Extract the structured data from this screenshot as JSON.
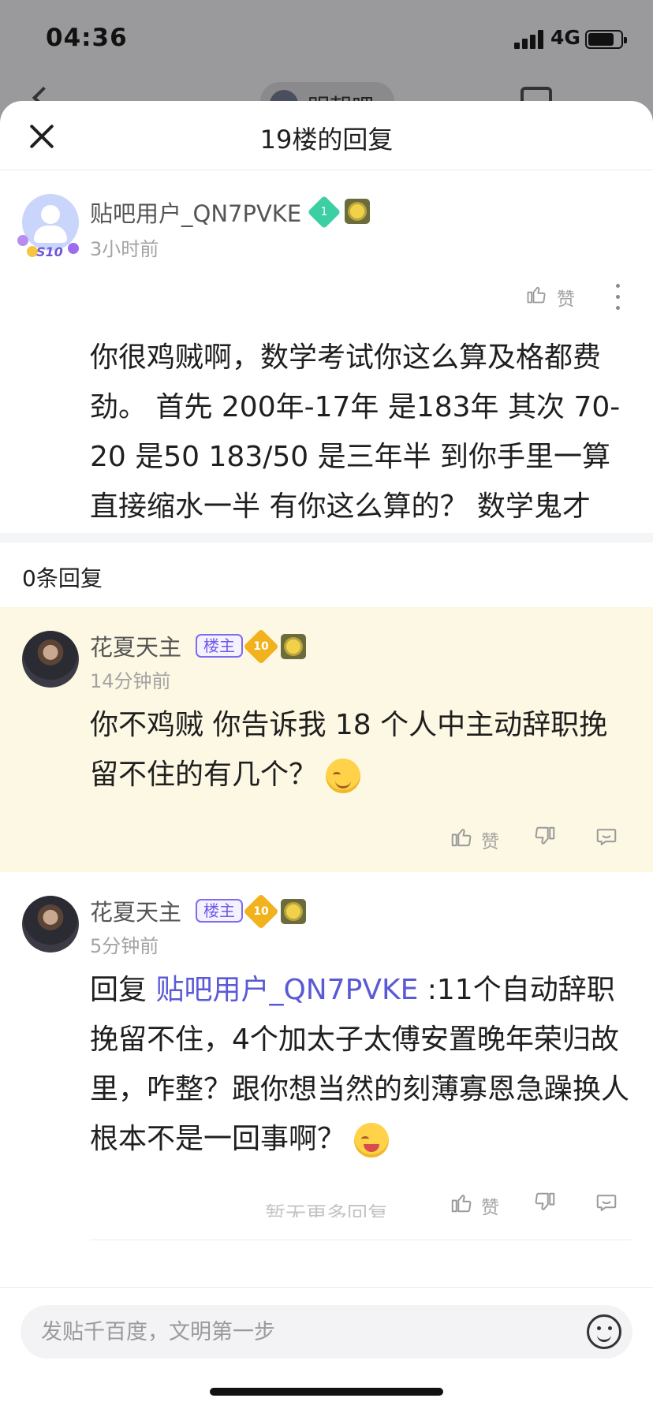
{
  "status_bar": {
    "time": "04:36",
    "network": "4G"
  },
  "background_nav": {
    "forum_name": "明朝吧"
  },
  "sheet": {
    "title": "19楼的回复",
    "main_post": {
      "username": "贴吧用户_QN7PVKE",
      "level": "1",
      "avatar_frame": "S10",
      "time": "3小时前",
      "like_label": "赞",
      "text": "你很鸡贼啊，数学考试你这么算及格都费劲。 首先 200年-17年 是183年 其次 70-20 是50 183/50 是三年半 到你手里一算直接缩水一半 有你这么算的？ 数学鬼才"
    },
    "reply_count": "0条回复",
    "replies": [
      {
        "username": "花夏天主",
        "tag": "楼主",
        "level": "10",
        "time": "14分钟前",
        "text": "你不鸡贼 你告诉我 18 个人中主动辞职挽留不住的有几个？",
        "like_label": "赞"
      },
      {
        "username": "花夏天主",
        "tag": "楼主",
        "level": "10",
        "time": "5分钟前",
        "reply_prefix": "回复 ",
        "mention": "贴吧用户_QN7PVKE",
        "text": " :11个自动辞职挽留不住，4个加太子太傅安置晚年荣归故里，咋整？跟你想当然的刻薄寡恩急躁换人 根本不是一回事啊？",
        "like_label": "赞"
      }
    ],
    "more_replies": "暂无更多回复"
  },
  "footer": {
    "input_placeholder": "发贴千百度，文明第一步"
  },
  "colors": {
    "accent": "#5a59d6",
    "highlight_bg": "#fdf8e4",
    "tag_border": "#7b6cf0"
  }
}
